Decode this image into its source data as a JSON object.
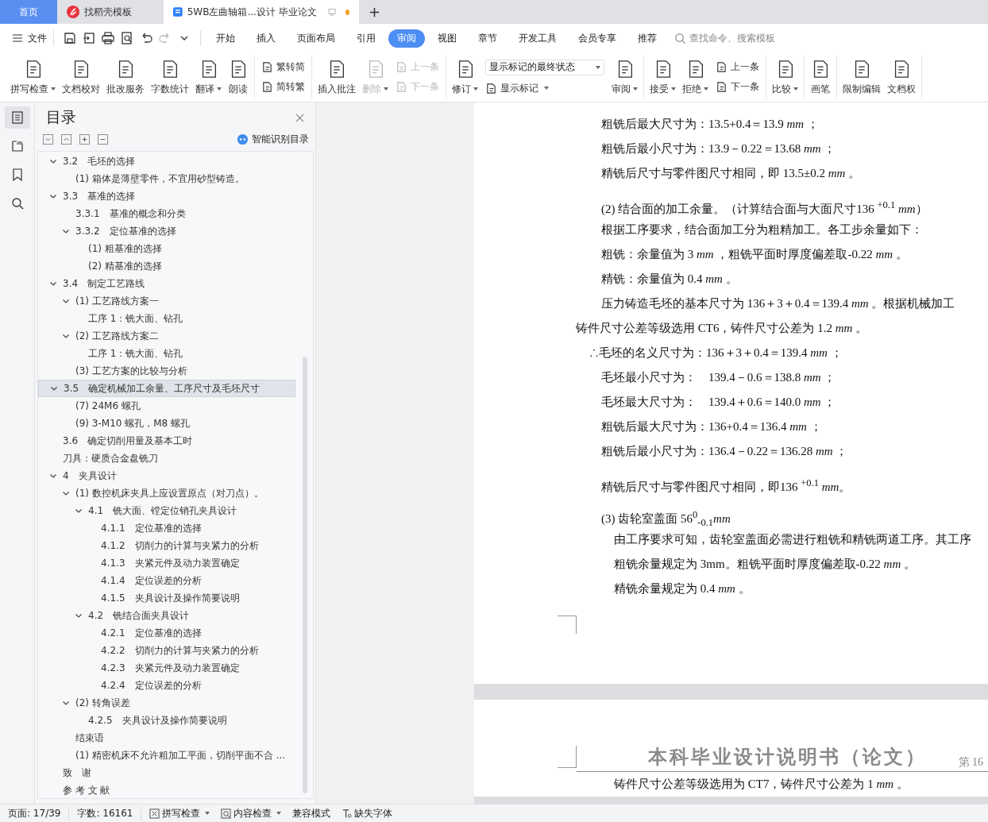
{
  "tabs": [
    {
      "label": "首页",
      "selected": false,
      "kind": "home"
    },
    {
      "label": "找稻壳模板",
      "selected": false,
      "kind": "templates"
    },
    {
      "label": "5WB左曲轴箱...设计 毕业论文",
      "selected": true,
      "kind": "doc",
      "unsaved": true
    }
  ],
  "menu": {
    "file": "文件",
    "quick_access": [
      {
        "disabled": false
      },
      {
        "disabled": false
      },
      {
        "disabled": false
      },
      {
        "disabled": false
      },
      {
        "disabled": false
      },
      {
        "disabled": true
      },
      {
        "disabled": false
      }
    ],
    "tabs": [
      {
        "label": "开始",
        "selected": false
      },
      {
        "label": "插入",
        "selected": false
      },
      {
        "label": "页面布局",
        "selected": false
      },
      {
        "label": "引用",
        "selected": false
      },
      {
        "label": "审阅",
        "selected": true
      },
      {
        "label": "视图",
        "selected": false
      },
      {
        "label": "章节",
        "selected": false
      },
      {
        "label": "开发工具",
        "selected": false
      },
      {
        "label": "会员专享",
        "selected": false
      },
      {
        "label": "推荐",
        "selected": false
      }
    ],
    "search": {
      "placeholder": "查找命令、搜索模板"
    }
  },
  "ribbon": [
    {
      "items": [
        {
          "kind": "large",
          "label": "拼写检查",
          "menu": true,
          "disabled": false
        },
        {
          "kind": "large",
          "label": "文档校对",
          "menu": false,
          "disabled": false
        },
        {
          "kind": "large",
          "label": "批改服务",
          "menu": false,
          "disabled": false
        },
        {
          "kind": "large",
          "label": "字数统计",
          "menu": false,
          "disabled": false
        },
        {
          "kind": "large",
          "label": "翻译",
          "menu": true,
          "disabled": false
        },
        {
          "kind": "large",
          "label": "朗读",
          "menu": false,
          "disabled": false
        }
      ]
    },
    {
      "items": [
        {
          "kind": "stack",
          "items": [
            {
              "kind": "small",
              "label": "繁转简",
              "menu": false,
              "disabled": false
            },
            {
              "kind": "small",
              "label": "简转繁",
              "menu": false,
              "disabled": false
            }
          ]
        }
      ]
    },
    {
      "items": [
        {
          "kind": "large",
          "label": "插入批注",
          "menu": false,
          "disabled": false
        },
        {
          "kind": "large",
          "label": "删除",
          "menu": true,
          "disabled": true
        },
        {
          "kind": "stack",
          "items": [
            {
              "kind": "small",
              "label": "上一条",
              "menu": false,
              "disabled": true
            },
            {
              "kind": "small",
              "label": "下一条",
              "menu": false,
              "disabled": true
            }
          ]
        }
      ]
    },
    {
      "items": [
        {
          "kind": "large",
          "label": "修订",
          "menu": true,
          "disabled": false
        },
        {
          "kind": "stack",
          "items": [
            {
              "kind": "select",
              "label": "显示标记的最终状态",
              "menu": true,
              "disabled": false
            },
            {
              "kind": "small",
              "label": "显示标记",
              "menu": true,
              "disabled": false
            }
          ]
        },
        {
          "kind": "large",
          "label": "审阅",
          "menu": true,
          "disabled": false
        }
      ]
    },
    {
      "items": [
        {
          "kind": "large",
          "label": "接受",
          "menu": true,
          "disabled": false
        },
        {
          "kind": "large",
          "label": "拒绝",
          "menu": true,
          "disabled": false
        },
        {
          "kind": "stack",
          "items": [
            {
              "kind": "small",
              "label": "上一条",
              "menu": false,
              "disabled": false
            },
            {
              "kind": "small",
              "label": "下一条",
              "menu": false,
              "disabled": false
            }
          ]
        }
      ]
    },
    {
      "items": [
        {
          "kind": "large",
          "label": "比较",
          "menu": true,
          "disabled": false
        }
      ]
    },
    {
      "items": [
        {
          "kind": "large",
          "label": "画笔",
          "menu": false,
          "disabled": false
        }
      ]
    },
    {
      "items": [
        {
          "kind": "large",
          "label": "限制编辑",
          "menu": false,
          "disabled": false
        },
        {
          "kind": "large",
          "label": "文档权",
          "menu": false,
          "disabled": false
        }
      ]
    }
  ],
  "rail": [
    {
      "selected": true
    },
    {
      "selected": false
    },
    {
      "selected": false
    },
    {
      "selected": false
    }
  ],
  "toc": {
    "title": "目录",
    "smart": "智能识别目录",
    "items": [
      {
        "label": "3.2　毛坯的选择",
        "selected": false,
        "expanded": true,
        "children": [
          {
            "label": "(1) 箱体是薄壁零件，不宜用砂型铸造。",
            "selected": false
          }
        ]
      },
      {
        "label": "3.3　基准的选择",
        "selected": false,
        "expanded": true,
        "children": [
          {
            "label": "3.3.1　基准的概念和分类",
            "selected": false
          },
          {
            "label": "3.3.2　定位基准的选择",
            "selected": false,
            "expanded": true,
            "children": [
              {
                "label": "(1) 粗基准的选择",
                "selected": false
              },
              {
                "label": "(2) 精基准的选择",
                "selected": false
              }
            ]
          }
        ]
      },
      {
        "label": "3.4　制定工艺路线",
        "selected": false,
        "expanded": true,
        "children": [
          {
            "label": "(1) 工艺路线方案一",
            "selected": false,
            "expanded": true,
            "children": [
              {
                "label": "工序 1：铣大面、钻孔",
                "selected": false
              }
            ]
          },
          {
            "label": "(2) 工艺路线方案二",
            "selected": false,
            "expanded": true,
            "children": [
              {
                "label": "工序 1：铣大面、钻孔",
                "selected": false
              }
            ]
          },
          {
            "label": "(3) 工艺方案的比较与分析",
            "selected": false
          }
        ]
      },
      {
        "label": "3.5　确定机械加工余量、工序尺寸及毛坯尺寸",
        "selected": true,
        "expanded": true,
        "children": [
          {
            "label": "(7) 24M6 螺孔",
            "selected": false
          },
          {
            "label": "(9) 3-M10 螺孔，M8 螺孔",
            "selected": false
          }
        ]
      },
      {
        "label": "3.6　确定切削用量及基本工时",
        "selected": false
      },
      {
        "label": "刀具：硬质合金盘铣刀",
        "selected": false
      },
      {
        "label": "4　夹具设计",
        "selected": false,
        "expanded": true,
        "children": [
          {
            "label": "(1) 数控机床夹具上应设置原点（对刀点）。",
            "selected": false,
            "expanded": true,
            "children": [
              {
                "label": "4.1　铣大面、镗定位销孔夹具设计",
                "selected": false,
                "expanded": true,
                "children": [
                  {
                    "label": "4.1.1　定位基准的选择",
                    "selected": false
                  },
                  {
                    "label": "4.1.2　切削力的计算与夹紧力的分析",
                    "selected": false
                  },
                  {
                    "label": "4.1.3　夹紧元件及动力装置确定",
                    "selected": false
                  },
                  {
                    "label": "4.1.4　定位误差的分析",
                    "selected": false
                  },
                  {
                    "label": "4.1.5　夹具设计及操作简要说明",
                    "selected": false
                  }
                ]
              },
              {
                "label": "4.2　铣结合面夹具设计",
                "selected": false,
                "expanded": true,
                "children": [
                  {
                    "label": "4.2.1　定位基准的选择",
                    "selected": false
                  },
                  {
                    "label": "4.2.2　切削力的计算与夹紧力的分析",
                    "selected": false
                  },
                  {
                    "label": "4.2.3　夹紧元件及动力装置确定",
                    "selected": false
                  },
                  {
                    "label": "4.2.4　定位误差的分析",
                    "selected": false
                  }
                ]
              }
            ]
          },
          {
            "label": "(2) 转角误差",
            "selected": false,
            "expanded": true,
            "children": [
              {
                "label": "4.2.5　夹具设计及操作简要说明",
                "selected": false
              }
            ]
          },
          {
            "label": "结束语",
            "selected": false
          },
          {
            "label": "(1) 精密机床不允许粗加工平面，切削平面不合 ...",
            "selected": false
          }
        ]
      },
      {
        "label": "致　谢",
        "selected": false
      },
      {
        "label": "参 考 文 献",
        "selected": false
      }
    ]
  },
  "document": {
    "pages": [
      {
        "paragraphs": [
          {
            "kind": "line",
            "text": "粗铣后最大尺寸为：13.5+0.4＝13.9 *mm* ；"
          },
          {
            "kind": "line",
            "text": "粗铣后最小尺寸为：13.9－0.22＝13.68 *mm* ；"
          },
          {
            "kind": "line",
            "text": "精铣后尺寸与零件图尺寸相同，即 13.5±0.2 *mm* 。"
          },
          {
            "kind": "gap",
            "text": "(2)  结合面的加工余量。（计算结合面与大面尺寸136 $^{+0.1}$ *mm*）"
          },
          {
            "kind": "line",
            "text": "根据工序要求，结合面加工分为粗精加工。各工步余量如下："
          },
          {
            "kind": "line",
            "text": "粗铣：余量值为 3 *mm* ，粗铣平面时厚度偏差取-0.22 *mm* 。"
          },
          {
            "kind": "line",
            "text": "精铣：余量值为 0.4 *mm* 。"
          },
          {
            "kind": "line",
            "text": "压力铸造毛坯的基本尺寸为 136＋3＋0.4＝139.4 *mm* 。根据机械加工"
          },
          {
            "kind": "flush",
            "text": "铸件尺寸公差等级选用 CT6，铸件尺寸公差为 1.2 *mm* 。"
          },
          {
            "kind": "therefore",
            "text": "∴毛坯的名义尺寸为：136＋3＋0.4＝139.4 *mm* ；"
          },
          {
            "kind": "line",
            "text": "毛坯最小尺寸为：　139.4－0.6＝138.8 *mm* ；"
          },
          {
            "kind": "line",
            "text": "毛坯最大尺寸为：　139.4＋0.6＝140.0 *mm* ；"
          },
          {
            "kind": "line",
            "text": "粗铣后最大尺寸为：136+0.4＝136.4 *mm* ；"
          },
          {
            "kind": "line",
            "text": "粗铣后最小尺寸为：136.4－0.22＝136.28 *mm* ；"
          },
          {
            "kind": "gap",
            "text": "精铣后尺寸与零件图尺寸相同，即136 $^{+0.1}$ *mm*。"
          },
          {
            "kind": "gap",
            "text": "(3)  齿轮室盖面 56$^{0}$$_{-0.1}$*mm*"
          },
          {
            "kind": "sub",
            "text": "由工序要求可知，齿轮室盖面必需进行粗铣和精铣两道工序。其工序"
          },
          {
            "kind": "sub",
            "text": "粗铣余量规定为 3mm。粗铣平面时厚度偏差取-0.22 *mm* 。"
          },
          {
            "kind": "sub",
            "text": "精铣余量规定为 0.4 *mm* 。"
          }
        ]
      },
      {
        "header": "本科毕业设计说明书（论文）",
        "page_label": "第 16",
        "paragraphs": [
          {
            "kind": "sub",
            "text": "铸件尺寸公差等级选用为 CT7，铸件尺寸公差为 1 *mm* 。"
          }
        ]
      }
    ]
  },
  "status_bar": {
    "page": "页面: 17/39",
    "words": "字数: 16161",
    "items": [
      {
        "label": "拼写检查",
        "menu": true
      },
      {
        "label": "内容检查",
        "menu": true
      },
      {
        "label": "兼容模式",
        "menu": false
      },
      {
        "label": "缺失字体",
        "menu": false
      }
    ]
  }
}
